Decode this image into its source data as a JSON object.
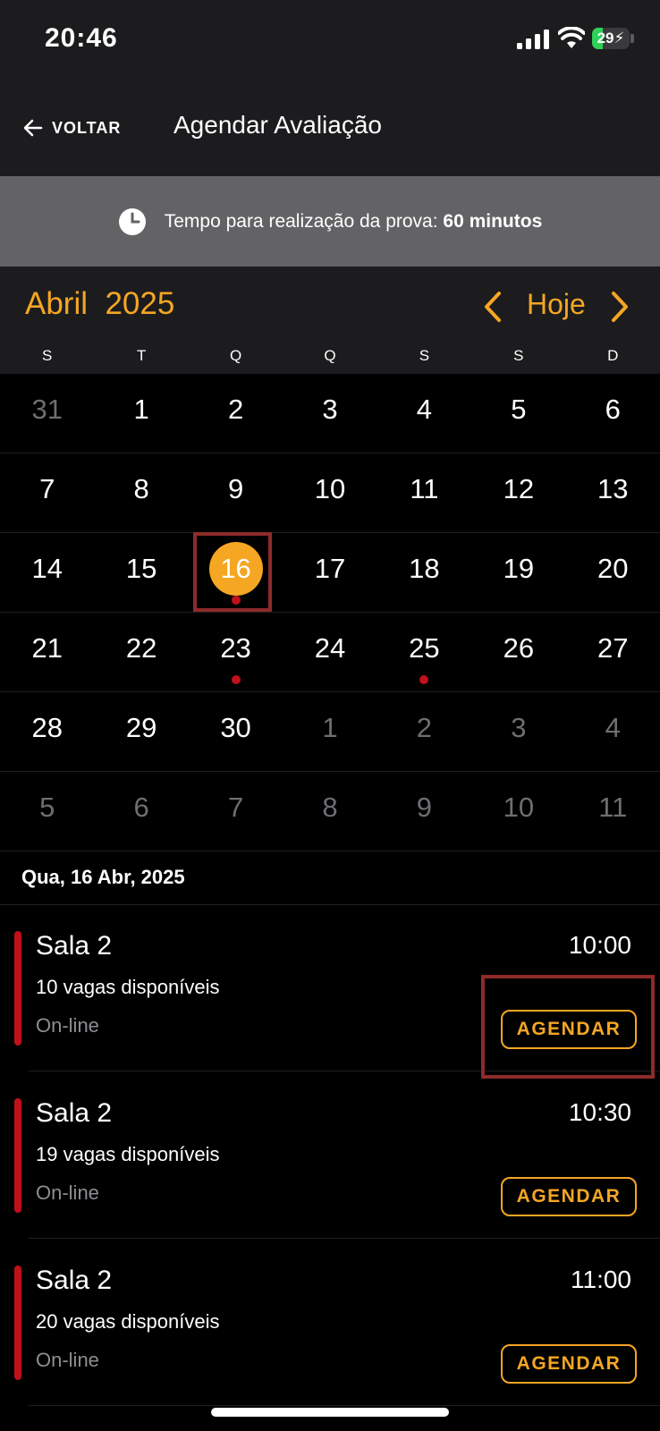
{
  "status_bar": {
    "time": "20:46",
    "battery": "29",
    "battery_level": 0.29
  },
  "nav": {
    "back_label": "VOLTAR",
    "title": "Agendar Avaliação"
  },
  "info": {
    "prefix": "Tempo para realização da prova: ",
    "duration": "60 minutos"
  },
  "calendar": {
    "month_year": "Abril  2025",
    "today_label": "Hoje",
    "weekdays": [
      "S",
      "T",
      "Q",
      "Q",
      "S",
      "S",
      "D"
    ],
    "days": [
      {
        "n": "31",
        "other": true
      },
      {
        "n": "1"
      },
      {
        "n": "2"
      },
      {
        "n": "3"
      },
      {
        "n": "4"
      },
      {
        "n": "5"
      },
      {
        "n": "6"
      },
      {
        "n": "7"
      },
      {
        "n": "8"
      },
      {
        "n": "9"
      },
      {
        "n": "10"
      },
      {
        "n": "11"
      },
      {
        "n": "12"
      },
      {
        "n": "13"
      },
      {
        "n": "14"
      },
      {
        "n": "15"
      },
      {
        "n": "16",
        "selected": true,
        "dot": true
      },
      {
        "n": "17"
      },
      {
        "n": "18"
      },
      {
        "n": "19"
      },
      {
        "n": "20"
      },
      {
        "n": "21"
      },
      {
        "n": "22"
      },
      {
        "n": "23",
        "dot": true
      },
      {
        "n": "24"
      },
      {
        "n": "25",
        "dot": true
      },
      {
        "n": "26"
      },
      {
        "n": "27"
      },
      {
        "n": "28"
      },
      {
        "n": "29"
      },
      {
        "n": "30"
      },
      {
        "n": "1",
        "other": true
      },
      {
        "n": "2",
        "other": true
      },
      {
        "n": "3",
        "other": true
      },
      {
        "n": "4",
        "other": true
      },
      {
        "n": "5",
        "other": true
      },
      {
        "n": "6",
        "other": true
      },
      {
        "n": "7",
        "other": true
      },
      {
        "n": "8",
        "other": true
      },
      {
        "n": "9",
        "other": true
      },
      {
        "n": "10",
        "other": true
      },
      {
        "n": "11",
        "other": true
      }
    ]
  },
  "selected_date": "Qua, 16 Abr, 2025",
  "slots": [
    {
      "room": "Sala 2",
      "vagas": "10 vagas disponíveis",
      "mode": "On-line",
      "time": "10:00",
      "button": "AGENDAR"
    },
    {
      "room": "Sala 2",
      "vagas": "19 vagas disponíveis",
      "mode": "On-line",
      "time": "10:30",
      "button": "AGENDAR"
    },
    {
      "room": "Sala 2",
      "vagas": "20 vagas disponíveis",
      "mode": "On-line",
      "time": "11:00",
      "button": "AGENDAR"
    }
  ],
  "colors": {
    "accent": "#f5a623",
    "event_dot": "#c0101a",
    "header_bg": "#1c1c1e",
    "info_bg": "#636366"
  }
}
